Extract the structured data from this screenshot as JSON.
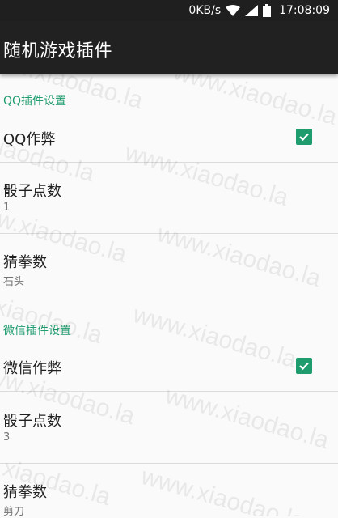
{
  "status_bar": {
    "speed": "0KB/s",
    "time": "17:08:09"
  },
  "app_bar": {
    "title": "随机游戏插件"
  },
  "watermark": "www.xiaodao.la",
  "colors": {
    "accent": "#1e9c6e",
    "app_bar": "#212121",
    "status_bar": "#1f1f1f"
  },
  "qq_section": {
    "header": "QQ插件设置",
    "cheat": {
      "label": "QQ作弊",
      "checked": true
    },
    "dice": {
      "label": "骰子点数",
      "value": "1"
    },
    "rps": {
      "label": "猜拳数",
      "value": "石头"
    }
  },
  "wechat_section": {
    "header": "微信插件设置",
    "cheat": {
      "label": "微信作弊",
      "checked": true
    },
    "dice": {
      "label": "骰子点数",
      "value": "3"
    },
    "rps": {
      "label": "猜拳数",
      "value": "剪刀"
    }
  }
}
